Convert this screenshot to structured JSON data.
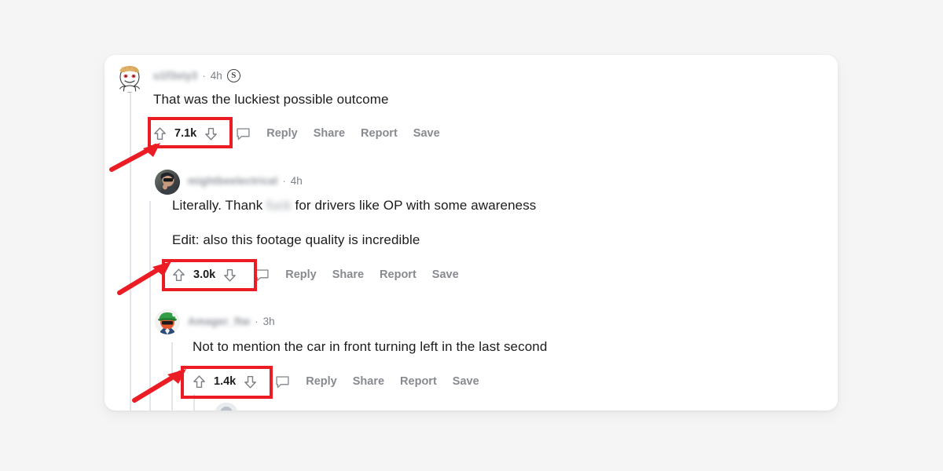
{
  "page": {
    "background_color": "#f5f5f5",
    "card_background": "#ffffff",
    "annotation_color": "#ec1c24",
    "platform": "reddit-comment-thread"
  },
  "comments": [
    {
      "id": "comment-1",
      "username": "u1f3sty3",
      "username_blurred": true,
      "timestamp": "4h",
      "badge": "S",
      "badge_name": "reddit-award-badge",
      "avatar_name": "avatar-cartoon-blond",
      "body_lines": [
        "That was the luckiest possible outcome"
      ],
      "score": "7.1k",
      "depth": 0,
      "actions": [
        "Reply",
        "Share",
        "Report",
        "Save"
      ],
      "upvote_label": "upvote",
      "downvote_label": "downvote",
      "annotated": true
    },
    {
      "id": "comment-2",
      "username": "mightbeelectrical",
      "username_blurred": true,
      "timestamp": "4h",
      "badge": null,
      "avatar_name": "avatar-photo-sunglasses",
      "body_lines": [
        "Literally. Thank ",
        "fuck",
        " for drivers like OP with some awareness"
      ],
      "body_line_2": "Edit: also this footage quality is incredible",
      "censored_word": "fuck",
      "score": "3.0k",
      "depth": 1,
      "actions": [
        "Reply",
        "Share",
        "Report",
        "Save"
      ],
      "annotated": true
    },
    {
      "id": "comment-3",
      "username": "Amager_ftw",
      "username_blurred": true,
      "timestamp": "3h",
      "badge": null,
      "avatar_name": "avatar-cartoon-green-hat",
      "body_lines": [
        "Not to mention the car in front turning left in the last second"
      ],
      "score": "1.4k",
      "depth": 2,
      "actions": [
        "Reply",
        "Share",
        "Report",
        "Save"
      ],
      "annotated": true
    }
  ],
  "annotations": {
    "boxes": [
      {
        "name": "score-highlight-1",
        "target_score": "7.1k"
      },
      {
        "name": "score-highlight-2",
        "target_score": "3.0k"
      },
      {
        "name": "score-highlight-3",
        "target_score": "1.4k"
      }
    ],
    "arrows": [
      {
        "name": "pointer-arrow-1",
        "points_to": "score-highlight-1"
      },
      {
        "name": "pointer-arrow-2",
        "points_to": "score-highlight-2"
      },
      {
        "name": "pointer-arrow-3",
        "points_to": "score-highlight-3"
      }
    ]
  },
  "partial_comment": {
    "id": "comment-4-partial",
    "visible": true,
    "note": "cut off at card bottom edge"
  }
}
